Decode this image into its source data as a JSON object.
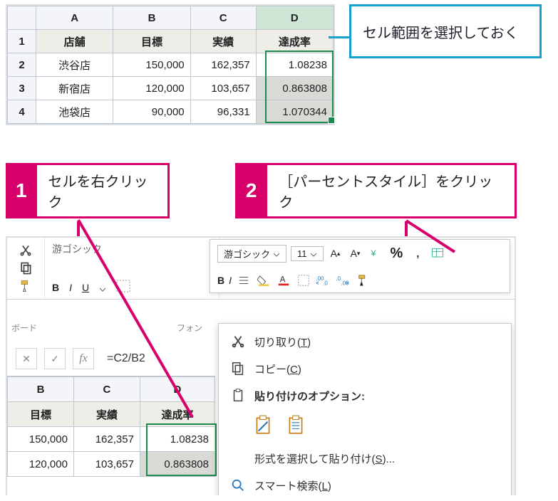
{
  "topSheet": {
    "cols": [
      "A",
      "B",
      "C",
      "D"
    ],
    "headerRow": [
      "店舗",
      "目標",
      "実績",
      "達成率"
    ],
    "rows": [
      {
        "n": "2",
        "store": "渋谷店",
        "target": "150,000",
        "actual": "162,357",
        "rate": "1.08238"
      },
      {
        "n": "3",
        "store": "新宿店",
        "target": "120,000",
        "actual": "103,657",
        "rate": "0.863808"
      },
      {
        "n": "4",
        "store": "池袋店",
        "target": "90,000",
        "actual": "96,331",
        "rate": "1.070344"
      }
    ]
  },
  "callout": "セル範囲を選択しておく",
  "step1": {
    "num": "1",
    "text": "セルを右クリック"
  },
  "step2": {
    "num": "2",
    "text": "［パーセントスタイル］をクリック"
  },
  "ribbon": {
    "fontName": "游ゴシック",
    "boardGroup": "ボード",
    "fontGroup": "フォン",
    "miniFont": "游ゴシック",
    "miniSize": "11",
    "percent": "%",
    "comma": ","
  },
  "ctx": {
    "cut": "切り取り(T)",
    "copy": "コピー(C)",
    "pasteOpt": "貼り付けのオプション:",
    "pasteSpecial": "形式を選択して貼り付け(S)...",
    "smart": "スマート検索(L)"
  },
  "fx": {
    "formula": "=C2/B2"
  },
  "grid2": {
    "cols": [
      "B",
      "C",
      "D"
    ],
    "headerRow": [
      "目標",
      "実績",
      "達成率"
    ],
    "rows": [
      {
        "target": "150,000",
        "actual": "162,357",
        "rate": "1.08238"
      },
      {
        "target": "120,000",
        "actual": "103,657",
        "rate": "0.863808"
      }
    ]
  },
  "indexOne": "1"
}
